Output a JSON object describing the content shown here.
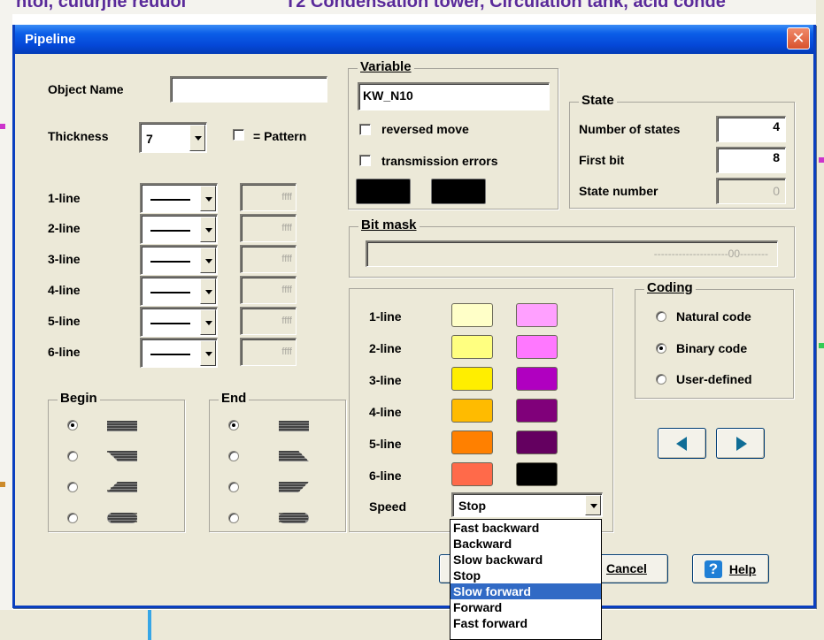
{
  "window": {
    "title": "Pipeline"
  },
  "object_name": {
    "label": "Object Name",
    "value": ""
  },
  "thickness": {
    "label": "Thickness",
    "value": "7"
  },
  "pattern": {
    "label": "= Pattern",
    "checked": false
  },
  "lines": [
    {
      "label": "1-line",
      "code": "ffff"
    },
    {
      "label": "2-line",
      "code": "ffff"
    },
    {
      "label": "3-line",
      "code": "ffff"
    },
    {
      "label": "4-line",
      "code": "ffff"
    },
    {
      "label": "5-line",
      "code": "ffff"
    },
    {
      "label": "6-line",
      "code": "ffff"
    }
  ],
  "begin": {
    "label": "Begin",
    "selected": 0
  },
  "end": {
    "label": "End",
    "selected": 0
  },
  "variable": {
    "label": "Variable",
    "value": "KW_N10",
    "reversed_move": "reversed move",
    "transmission_errors": "transmission errors"
  },
  "state": {
    "label": "State",
    "number_of_states": {
      "label": "Number of states",
      "value": "4"
    },
    "first_bit": {
      "label": "First bit",
      "value": "8"
    },
    "state_number": {
      "label": "State number",
      "value": "0"
    }
  },
  "bit_mask": {
    "label": "Bit mask",
    "value": "---------------------00--------"
  },
  "colors": {
    "rows": [
      {
        "label": "1-line",
        "left": "#ffffc8",
        "right": "#ffa0ff"
      },
      {
        "label": "2-line",
        "left": "#ffff80",
        "right": "#ff78ff"
      },
      {
        "label": "3-line",
        "left": "#ffee00",
        "right": "#b000c0"
      },
      {
        "label": "4-line",
        "left": "#ffbb00",
        "right": "#80007a"
      },
      {
        "label": "5-line",
        "left": "#ff8000",
        "right": "#640060"
      },
      {
        "label": "6-line",
        "left": "#ff6a4a",
        "right": "#000000"
      }
    ],
    "speed_label": "Speed",
    "speed_value": "Stop"
  },
  "coding": {
    "label": "Coding",
    "options": [
      "Natural code",
      "Binary code",
      "User-defined"
    ],
    "selected": 1
  },
  "buttons": {
    "cancel": "Cancel",
    "help": "Help"
  },
  "speed_dropdown": {
    "options": [
      "Fast backward",
      "Backward",
      "Slow backward",
      "Stop",
      "Slow forward",
      "Forward",
      "Fast forward"
    ],
    "highlighted": 4
  },
  "background_text": {
    "left": "ntoi, cuiurjne reuuoi",
    "right": "T2 Condensation tower, Circulation tank, acid conde"
  }
}
